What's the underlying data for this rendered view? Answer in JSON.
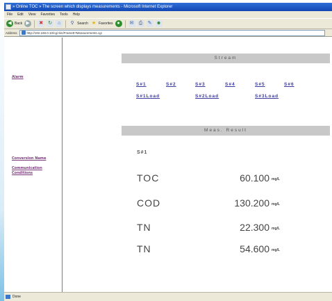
{
  "window": {
    "title": "» Online TOC » The screen which displays measurements - Microsoft Internet Explorer"
  },
  "menubar": [
    "File",
    "Edit",
    "View",
    "Favorites",
    "Tools",
    "Help"
  ],
  "toolbar": {
    "back_label": "Back",
    "search_label": "Search",
    "favorites_label": "Favorites"
  },
  "address": {
    "label": "Address",
    "url": "http://192.168.0.10/cgi-bin/Frame5?Measurements.cgi"
  },
  "sidebar": {
    "alarm": "Alarm",
    "conversion_name": "Conversion Name",
    "communication_line1": "Communication",
    "communication_line2": "Conditions"
  },
  "stream_section": {
    "title": "Stream",
    "streams": [
      "S#1",
      "S#2",
      "S#3",
      "S#4",
      "S#5",
      "S#6"
    ],
    "loads": [
      "S#1Load",
      "S#2Load",
      "S#3Load"
    ]
  },
  "result_section": {
    "title": "Meas. Result",
    "selected_stream": "S#1",
    "rows": [
      {
        "name": "TOC",
        "value": "60.100",
        "unit": "mg/L"
      },
      {
        "name": "COD",
        "value": "130.200",
        "unit": "mg/L"
      },
      {
        "name": "TN",
        "value": "22.300",
        "unit": "mg/L"
      },
      {
        "name": "TN",
        "value": "54.600",
        "unit": "mg/L"
      }
    ]
  },
  "statusbar": {
    "text": "Done"
  }
}
